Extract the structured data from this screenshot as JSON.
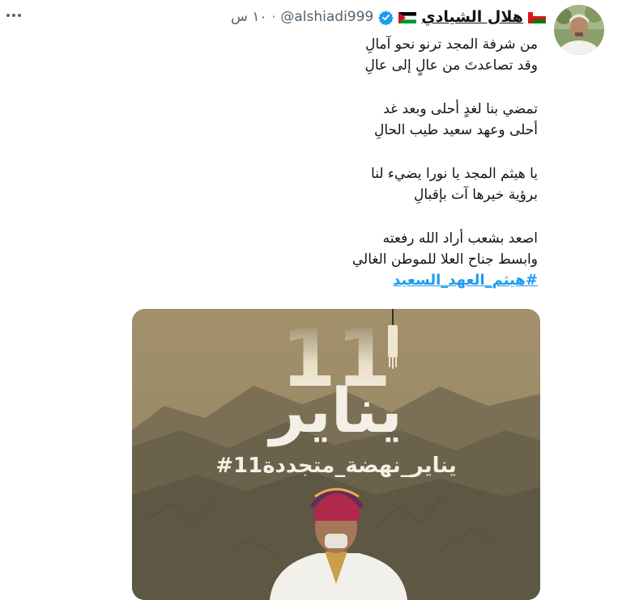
{
  "tweet": {
    "author": {
      "display_name": "هلال الشيادي",
      "handle": "@alshiadi999",
      "flags": [
        "oman-flag",
        "palestine-flag"
      ],
      "verified": true
    },
    "time": "١٠ س",
    "text_lines": [
      "من شرفة المجد ترنو نحو آمالِ",
      "وقد تصاعدتَ من عالٍ إلى عالِ",
      "",
      "تمضي بنا لغدٍ أحلى وبعد غد",
      "أحلى وعهد سعيد طيب الحالِ",
      "",
      "يا هيثم المجد يا نورا يضيء لنا",
      "برؤية خيرها آت بإقبالِ",
      "",
      "اصعد بشعب أراد الله رفعته",
      "وابسط جناح العلا للموطن الغالي"
    ],
    "hashtag": "#هيثم_العهد_السعيد",
    "media": {
      "big_number": "11",
      "big_word": "يناير",
      "caption": "#11يناير_نهضة_متجددة",
      "colors": {
        "top": "#9a8a68",
        "bottom": "#6e6650",
        "text": "#f4f0e6"
      }
    },
    "icons": {
      "more": "more-icon",
      "verified": "verified-badge-icon"
    }
  }
}
